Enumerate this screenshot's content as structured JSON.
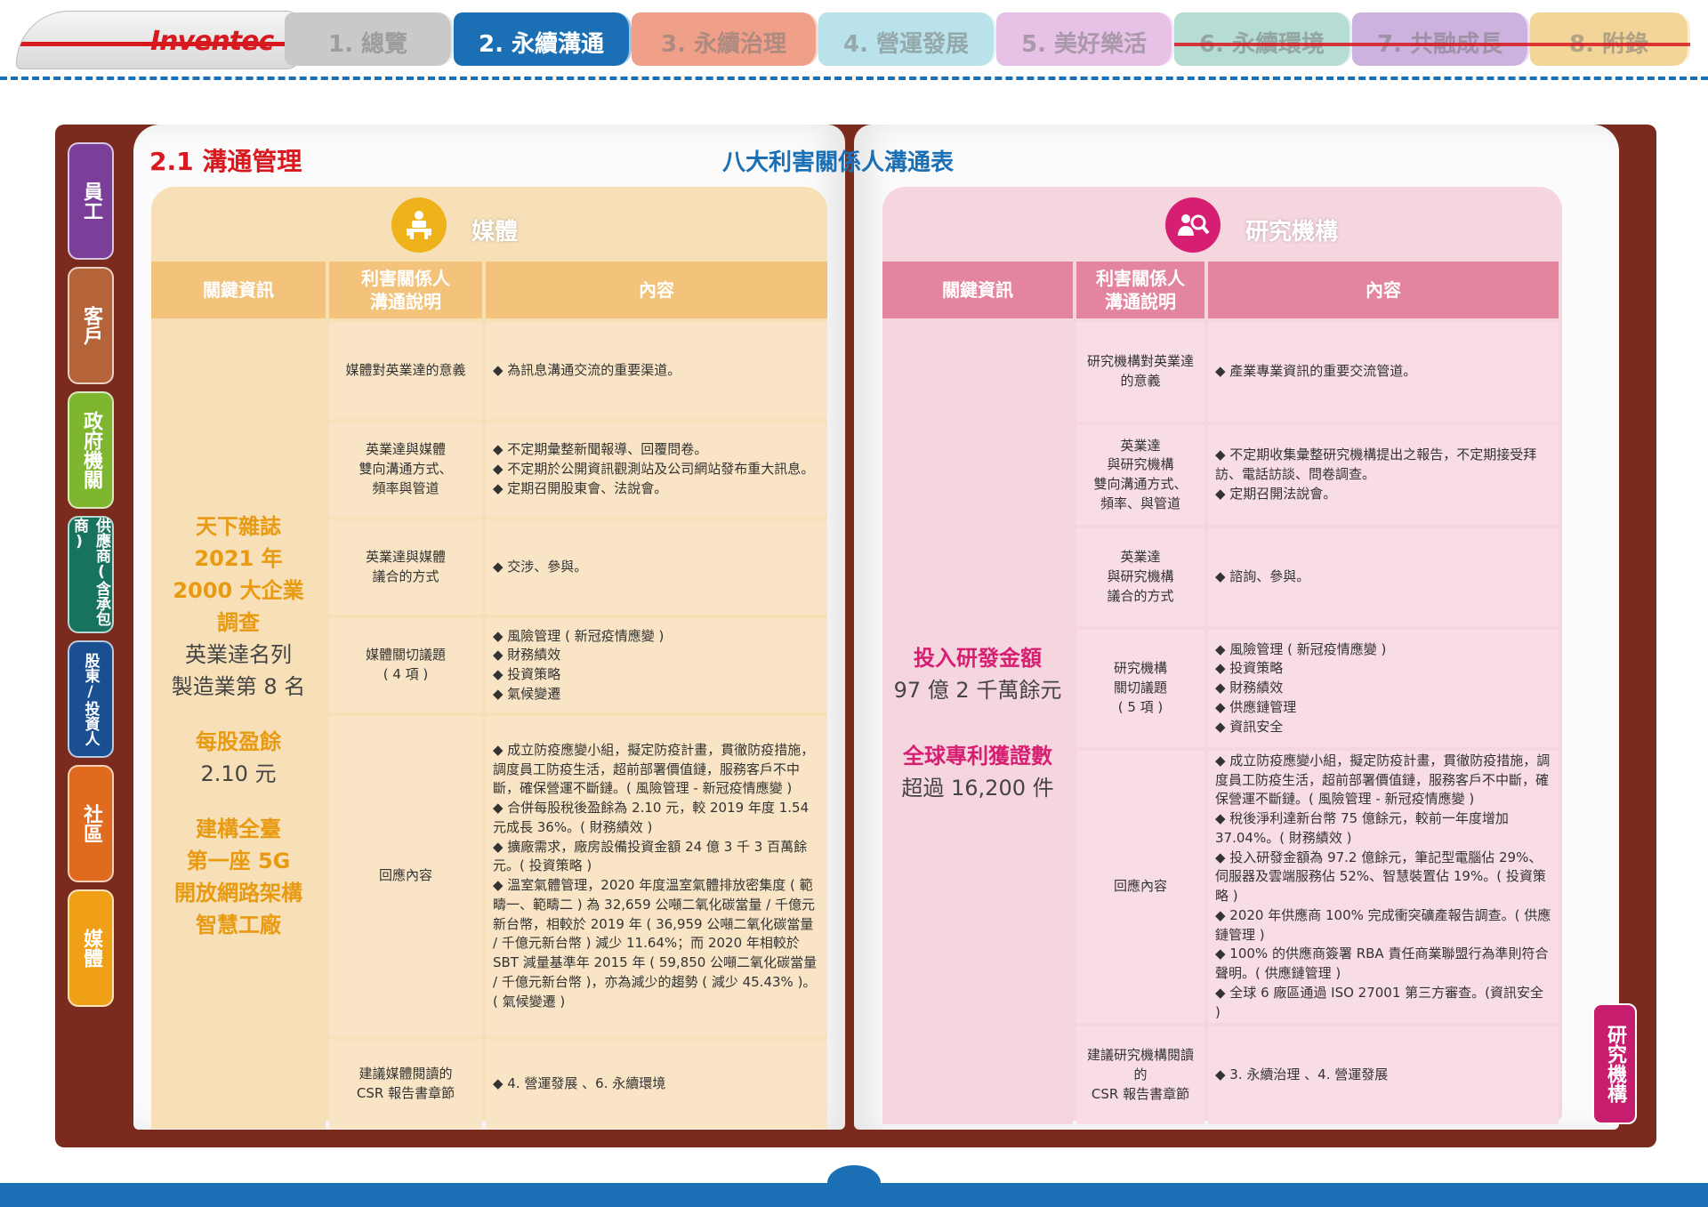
{
  "brand": {
    "logo": "Inventec"
  },
  "nav": [
    {
      "label": "1. 總覽",
      "color": "#c9c9c9"
    },
    {
      "label": "2. 永續溝通",
      "color": "#1a6fb5",
      "active": true
    },
    {
      "label": "3. 永續治理",
      "color": "#f0a089"
    },
    {
      "label": "4. 營運發展",
      "color": "#b9e2ea"
    },
    {
      "label": "5. 美好樂活",
      "color": "#e7c2e6"
    },
    {
      "label": "6. 永續環境",
      "color": "#b6ddd3"
    },
    {
      "label": "7. 共融成長",
      "color": "#cdb2df"
    },
    {
      "label": "8. 附錄",
      "color": "#f3d59a"
    }
  ],
  "side_tabs": [
    {
      "label": "員工",
      "color": "#7b3f9a"
    },
    {
      "label": "客戶",
      "color": "#b5643a"
    },
    {
      "label": "政府機關",
      "color": "#7fb62f"
    },
    {
      "label": "供應商(含承包商)",
      "color": "#17735e"
    },
    {
      "label": "股東/投資人",
      "color": "#1a4f91"
    },
    {
      "label": "社區",
      "color": "#e06a1d"
    },
    {
      "label": "媒體",
      "color": "#f0a017"
    }
  ],
  "section_title": "2.1 溝通管理",
  "table_title": "八大利害關係人溝通表",
  "left": {
    "title": "媒體",
    "accent": "#f3c27b",
    "headers": [
      "關鍵資訊",
      "利害關係人\n溝通說明",
      "內容"
    ],
    "key_info": [
      {
        "text": "天下雜誌",
        "bold": true
      },
      {
        "text": "2021 年",
        "bold": true
      },
      {
        "text": "2000 大企業",
        "bold": true
      },
      {
        "text": "調查",
        "bold": true
      },
      {
        "text": "英業達名列",
        "bold": false
      },
      {
        "text": "製造業第 8 名",
        "bold": false
      },
      {
        "text": "每股盈餘",
        "bold": true
      },
      {
        "text": "2.10 元",
        "bold": false
      },
      {
        "text": "建構全臺",
        "bold": true
      },
      {
        "text": "第一座 5G",
        "bold": true
      },
      {
        "text": "開放網路架構",
        "bold": true
      },
      {
        "text": "智慧工廠",
        "bold": true
      }
    ],
    "rows": [
      {
        "desc": "媒體對英業達的意義",
        "content": [
          "◆ 為訊息溝通交流的重要渠道。"
        ]
      },
      {
        "desc": "英業達與媒體\n雙向溝通方式、\n頻率與管道",
        "content": [
          "◆ 不定期彙整新聞報導、回覆問卷。",
          "◆ 不定期於公開資訊觀測站及公司網站發布重大訊息。",
          "◆ 定期召開股東會、法說會。"
        ]
      },
      {
        "desc": "英業達與媒體\n議合的方式",
        "content": [
          "◆ 交涉、參與。"
        ]
      },
      {
        "desc": "媒體關切議題\n( 4 項 )",
        "content": [
          "◆ 風險管理 ( 新冠疫情應變 )",
          "◆ 財務績效",
          "◆ 投資策略",
          "◆ 氣候變遷"
        ]
      },
      {
        "desc": "回應內容",
        "content": [
          "◆ 成立防疫應變小組，擬定防疫計畫，貫徹防疫措施，調度員工防疫生活，超前部署價值鏈，服務客戶不中斷，確保營運不斷鏈。( 風險管理 - 新冠疫情應變 )",
          "◆ 合併每股稅後盈餘為 2.10 元，較 2019 年度 1.54 元成長 36%。( 財務績效 )",
          "◆ 擴廠需求，廠房設備投資金額 24 億 3 千 3 百萬餘元。( 投資策略 )",
          "◆ 溫室氣體管理，2020 年度溫室氣體排放密集度 ( 範疇一、範疇二 ) 為 32,659 公噸二氧化碳當量 / 千億元新台幣，相較於 2019 年 ( 36,959 公噸二氧化碳當量 / 千億元新台幣 ) 減少 11.64%；而 2020 年相較於 SBT 減量基準年 2015 年 ( 59,850 公噸二氧化碳當量 / 千億元新台幣 )，亦為減少的趨勢 ( 減少 45.43% )。( 氣候變遷 )"
        ]
      },
      {
        "desc": "建議媒體閱讀的\nCSR 報告書章節",
        "content": [
          "◆ 4. 營運發展 、6. 永續環境"
        ]
      }
    ]
  },
  "right": {
    "title": "研究機構",
    "accent": "#e4859f",
    "headers": [
      "關鍵資訊",
      "利害關係人\n溝通說明",
      "內容"
    ],
    "key_info": [
      {
        "text": "投入研發金額",
        "bold": true
      },
      {
        "text": "97 億 2 千萬餘元",
        "bold": false
      },
      {
        "text": "全球專利獲證數",
        "bold": true
      },
      {
        "text": "超過 16,200 件",
        "bold": false
      }
    ],
    "rows": [
      {
        "desc": "研究機構對英業達\n的意義",
        "content": [
          "◆ 產業專業資訊的重要交流管道。"
        ]
      },
      {
        "desc": "英業達\n與研究機構\n雙向溝通方式、\n頻率、與管道",
        "content": [
          "◆ 不定期收集彙整研究機構提出之報告，不定期接受拜訪、電話訪談、問卷調查。",
          "◆ 定期召開法說會。"
        ]
      },
      {
        "desc": "英業達\n與研究機構\n議合的方式",
        "content": [
          "◆ 諮詢、參與。"
        ]
      },
      {
        "desc": "研究機構\n關切議題\n( 5 項 )",
        "content": [
          "◆ 風險管理 ( 新冠疫情應變 )",
          "◆ 投資策略",
          "◆ 財務績效",
          "◆ 供應鏈管理",
          "◆ 資訊安全"
        ]
      },
      {
        "desc": "回應內容",
        "content": [
          "◆ 成立防疫應變小組，擬定防疫計畫，貫徹防疫措施，調度員工防疫生活，超前部署價值鏈，服務客戶不中斷，確保營運不斷鏈。( 風險管理 - 新冠疫情應變 )",
          "◆ 稅後淨利達新台幣 75 億餘元，較前一年度增加 37.04%。( 財務績效 )",
          "◆ 投入研發金額為 97.2 億餘元，筆記型電腦佔 29%、伺服器及雲端服務佔 52%、智慧裝置佔 19%。( 投資策略 )",
          "◆ 2020 年供應商 100% 完成衝突礦產報告調查。( 供應鏈管理 )",
          "◆ 100% 的供應商簽署 RBA 責任商業聯盟行為準則符合聲明。( 供應鏈管理 )",
          "◆ 全球 6 廠區通過 ISO 27001 第三方審查。(資訊安全 )"
        ]
      },
      {
        "desc": "建議研究機構閱讀的\nCSR 報告書章節",
        "content": [
          "◆ 3. 永續治理 、4. 營運發展"
        ]
      }
    ]
  },
  "corner_tab": "研究機構"
}
